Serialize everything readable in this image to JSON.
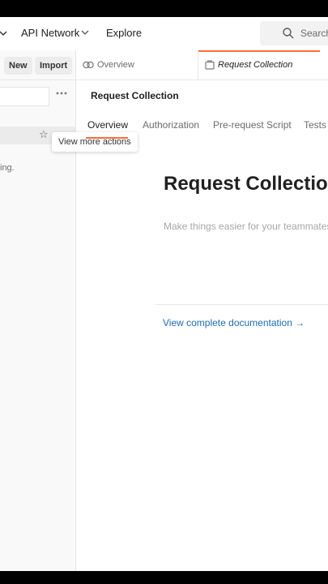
{
  "topbar": {
    "api_network": "API Network",
    "explore": "Explore",
    "search_label": "Search"
  },
  "sidebar": {
    "new_button": "New",
    "import_button": "Import",
    "partial_text": "ing."
  },
  "tooltip": {
    "text": "View more actions"
  },
  "tabs": [
    {
      "label": "Overview",
      "icon": "overview-icon"
    },
    {
      "label": "Request Collection",
      "icon": "collection-icon",
      "active": true
    }
  ],
  "main": {
    "header_title": "Request Collection",
    "subtabs": [
      "Overview",
      "Authorization",
      "Pre-request Script",
      "Tests"
    ],
    "doc_title": "Request Collection",
    "doc_placeholder": "Make things easier for your teammates",
    "doc_link": "View complete documentation →"
  },
  "colors": {
    "accent": "#ff6c37",
    "link": "#1f6bb0"
  }
}
